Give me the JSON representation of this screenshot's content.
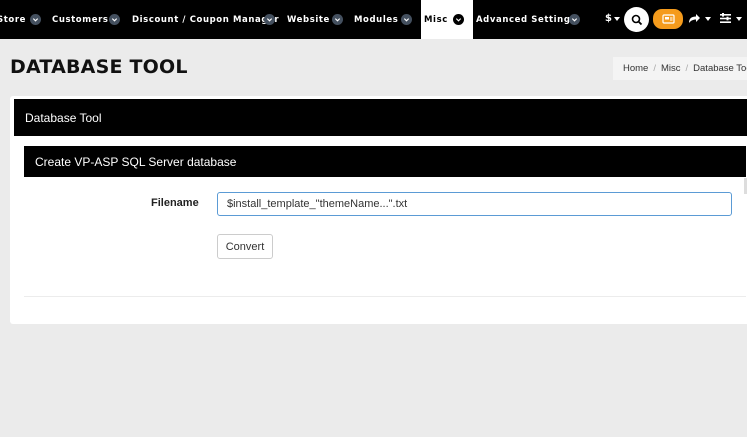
{
  "nav": {
    "items": [
      {
        "label": "Store"
      },
      {
        "label": "Customers"
      },
      {
        "label": "Discount / Coupon Manager"
      },
      {
        "label": "Website"
      },
      {
        "label": "Modules"
      },
      {
        "label": "Misc"
      },
      {
        "label": "Advanced Settings"
      }
    ],
    "currency": "$"
  },
  "header": {
    "title": "DATABASE TOOL",
    "breadcrumb": [
      "Home",
      "Misc",
      "Database Tool"
    ]
  },
  "panel": {
    "title": "Database Tool",
    "section_title": "Create VP-ASP SQL Server database",
    "filename_label": "Filename",
    "filename_value": "$install_template_\"themeName...\".txt",
    "convert_label": "Convert"
  },
  "colors": {
    "nav_bg": "#000000",
    "accent_orange": "#f59b1c",
    "chevron_bg": "#44505f"
  }
}
